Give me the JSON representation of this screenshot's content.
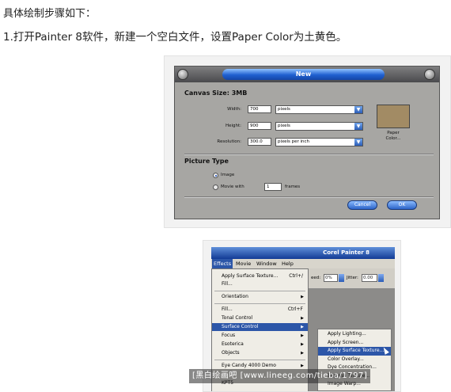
{
  "intro": "具体绘制步骤如下：",
  "step1": "1.打开Painter 8软件，新建一个空白文件，设置Paper Color为土黄色。",
  "new_dialog": {
    "title": "New",
    "canvas_size": "Canvas Size: 3MB",
    "width_label": "Width:",
    "width_value": "700",
    "width_unit": "pixels",
    "height_label": "Height:",
    "height_value": "900",
    "height_unit": "pixels",
    "resolution_label": "Resolution:",
    "resolution_value": "300.0",
    "resolution_unit": "pixels per inch",
    "paper_color_label": "Paper Color...",
    "paper_color": "#a28b64",
    "picture_type": "Picture Type",
    "image_label": "Image",
    "movie_label": "Movie with",
    "movie_frames": "1",
    "frames_label": "frames",
    "cancel": "Cancel",
    "ok": "OK"
  },
  "painter": {
    "title": "Corel Painter 8",
    "menubar": [
      "Effects",
      "Movie",
      "Window",
      "Help"
    ],
    "toolbar": {
      "feed_label": "eed:",
      "feed_value": "0%",
      "jitter_label": "Jitter:",
      "jitter_value": "0.00"
    },
    "effects_menu": [
      {
        "label": "Apply Surface Texture...",
        "shortcut": "Ctrl+/"
      },
      {
        "label": "Fill...",
        "shortcut": ""
      },
      {
        "label": "Orientation",
        "shortcut": "▶"
      },
      {
        "label": "Fill...",
        "shortcut": "Ctrl+F"
      },
      {
        "label": "Tonal Control",
        "shortcut": "▶"
      },
      {
        "label": "Surface Control",
        "shortcut": "▶"
      },
      {
        "label": "Focus",
        "shortcut": "▶"
      },
      {
        "label": "Esoterica",
        "shortcut": "▶"
      },
      {
        "label": "Objects",
        "shortcut": "▶"
      },
      {
        "label": "Eye Candy 4000 Demo",
        "shortcut": "▶"
      },
      {
        "label": "KPT5",
        "shortcut": ""
      }
    ],
    "surface_control_submenu": [
      "Apply Lighting...",
      "Apply Screen...",
      "Apply Surface Texture...",
      "Color Overlay...",
      "Dye Concentration...",
      "Express Texture...",
      "Image Warp..."
    ]
  },
  "watermark": "[黑白绘画吧 [www.lineeg.com/tieba/1797]"
}
